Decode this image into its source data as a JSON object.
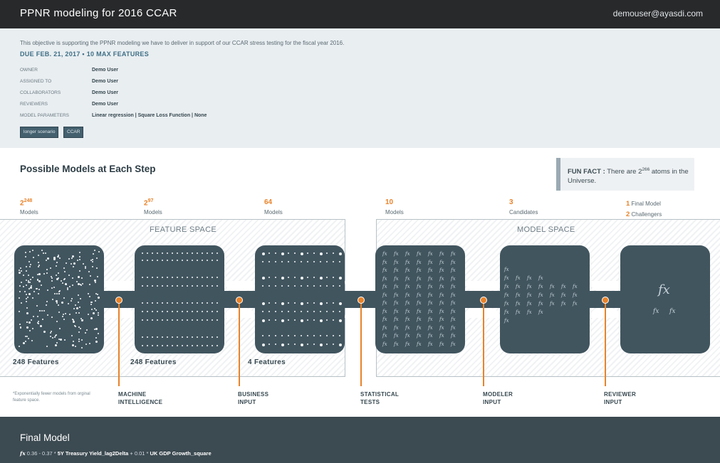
{
  "header": {
    "title": "PPNR modeling for 2016 CCAR",
    "user": "demouser@ayasdi.com"
  },
  "objective": {
    "description": "This objective is supporting the PPNR modeling we have to deliver in support of our CCAR stress testing for the fiscal year 2016.",
    "due": "DUE FEB. 21, 2017  •  10 MAX FEATURES",
    "fields": [
      {
        "label": "OWNER",
        "value": "Demo User"
      },
      {
        "label": "ASSIGNED TO",
        "value": "Demo User"
      },
      {
        "label": "COLLABORATORS",
        "value": "Demo User"
      },
      {
        "label": "REVIEWERS",
        "value": "Demo User"
      },
      {
        "label": "MODEL PARAMETERS",
        "value": "Linear regression | Square Loss Function | None"
      }
    ],
    "tags": [
      "longer scenario",
      "CCAR"
    ]
  },
  "section_title": "Possible Models at Each Step",
  "fun_fact": {
    "label": "FUN FACT :",
    "text_before": "There are 2",
    "exponent": "266",
    "text_after": " atoms in the Universe."
  },
  "steps": [
    {
      "base": "2",
      "exp": "248",
      "sub": "Models"
    },
    {
      "base": "2",
      "exp": "97",
      "sub": "Models"
    },
    {
      "base": "64",
      "exp": "",
      "sub": "Models"
    },
    {
      "base": "10",
      "exp": "",
      "sub": "Models"
    },
    {
      "base": "3",
      "exp": "",
      "sub": "Candidates"
    }
  ],
  "final": {
    "n1": "1",
    "t1": "Final Model",
    "n2": "2",
    "t2": "Challengers"
  },
  "spaces": {
    "feature": "FEATURE SPACE",
    "model": "MODEL SPACE"
  },
  "feature_labels": [
    "248 Features",
    "248 Features",
    "4 Features"
  ],
  "stage_labels": [
    {
      "line1": "MACHINE",
      "line2": "INTELLIGENCE"
    },
    {
      "line1": "BUSINESS",
      "line2": "INPUT"
    },
    {
      "line1": "STATISTICAL",
      "line2": "TESTS"
    },
    {
      "line1": "MODELER",
      "line2": "INPUT"
    },
    {
      "line1": "REVIEWER",
      "line2": "INPUT"
    }
  ],
  "footnote": "*Exponentially fewer models from orginal feature space.",
  "fx_symbol": "fx",
  "final_model": {
    "title": "Final Model",
    "formula_prefix": "0.36 - 0.37 * ",
    "term1": "5Y Treasury Yield_lag2Delta",
    "formula_mid": " + 0.01 * ",
    "term2": "UK GDP Growth_square"
  },
  "colors": {
    "accent": "#e8832a",
    "tile": "#41555f",
    "topbar": "#28292b",
    "footer": "#3c4a51"
  }
}
